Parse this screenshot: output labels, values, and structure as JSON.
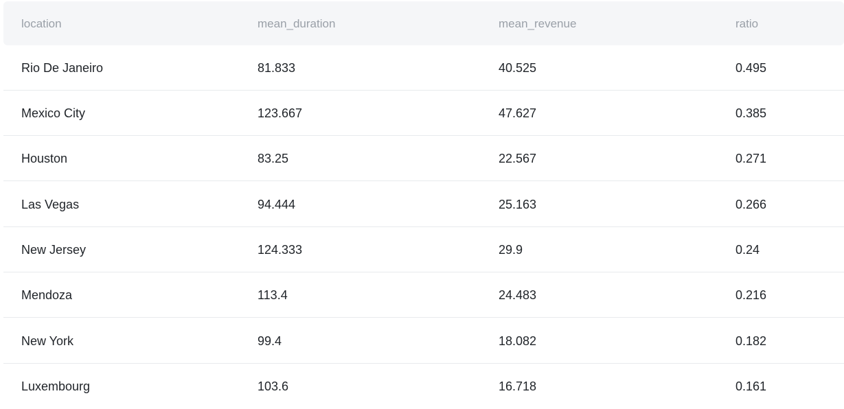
{
  "table": {
    "headers": [
      "location",
      "mean_duration",
      "mean_revenue",
      "ratio"
    ],
    "rows": [
      [
        "Rio De Janeiro",
        "81.833",
        "40.525",
        "0.495"
      ],
      [
        "Mexico City",
        "123.667",
        "47.627",
        "0.385"
      ],
      [
        "Houston",
        "83.25",
        "22.567",
        "0.271"
      ],
      [
        "Las Vegas",
        "94.444",
        "25.163",
        "0.266"
      ],
      [
        "New Jersey",
        "124.333",
        "29.9",
        "0.24"
      ],
      [
        "Mendoza",
        "113.4",
        "24.483",
        "0.216"
      ],
      [
        "New York",
        "99.4",
        "18.082",
        "0.182"
      ],
      [
        "Luxembourg",
        "103.6",
        "16.718",
        "0.161"
      ]
    ]
  },
  "colors": {
    "header_background": "#f5f6f8",
    "header_text": "#9aa0a8",
    "body_text": "#1f2328",
    "row_divider": "#e8eaed"
  }
}
